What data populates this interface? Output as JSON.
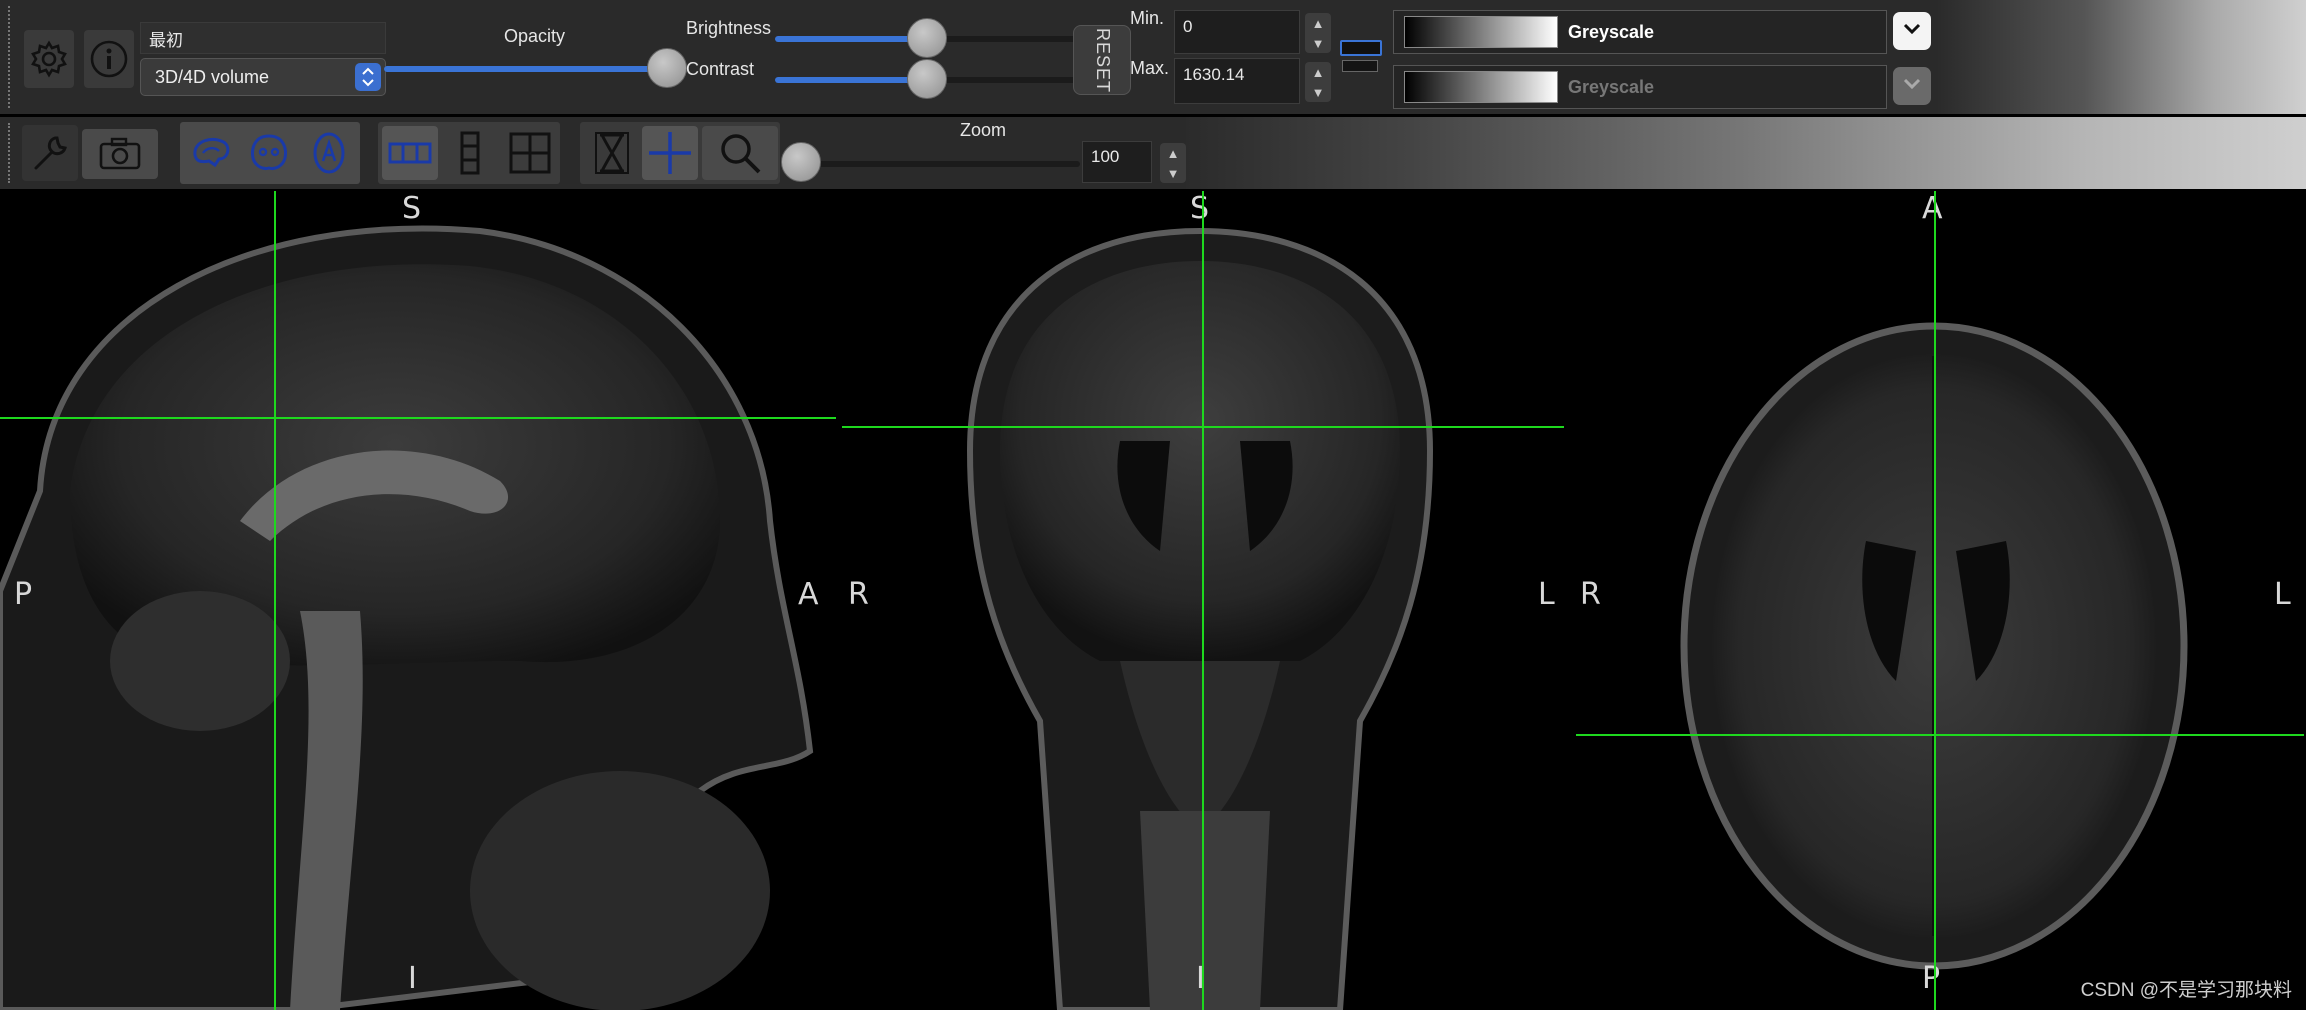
{
  "volume": {
    "name": "最初",
    "type_value": "3D/4D volume"
  },
  "opacity": {
    "label": "Opacity",
    "value": 1.0
  },
  "brightness": {
    "label": "Brightness",
    "value": 0.5
  },
  "contrast": {
    "label": "Contrast",
    "value": 0.5
  },
  "reset_label": "RESET",
  "range": {
    "min_label": "Min.",
    "min_value": "0",
    "max_label": "Max.",
    "max_value": "1630.14"
  },
  "colormap": {
    "primary": "Greyscale",
    "secondary": "Greyscale"
  },
  "zoom": {
    "label": "Zoom",
    "value": "100",
    "level": 0.0
  },
  "views": {
    "sagittal": {
      "top": "S",
      "bottom": "I",
      "left": "P",
      "right": "A"
    },
    "coronal": {
      "top": "S",
      "bottom": "I",
      "left": "R",
      "right": "L"
    },
    "axial": {
      "top": "A",
      "bottom": "P",
      "left": "R",
      "right": "L"
    }
  },
  "watermark": "CSDN @不是学习那块料",
  "colors": {
    "crosshair": "#1ed81e",
    "accent": "#3a74d6",
    "toolbar": "#2a2a2a"
  },
  "icons": {
    "settings": "gear-icon",
    "info": "info-icon",
    "tools": "wrench-icon",
    "screenshot": "camera-icon",
    "sagittal": "sagittal-brain-icon",
    "coronal": "coronal-brain-icon",
    "axial": "axial-brain-icon",
    "layout_horizontal": "three-column-layout-icon",
    "layout_vertical": "three-row-layout-icon",
    "layout_grid": "grid-layout-icon",
    "movie": "film-icon",
    "crosshair": "crosshair-icon",
    "zoom": "magnifier-icon"
  }
}
